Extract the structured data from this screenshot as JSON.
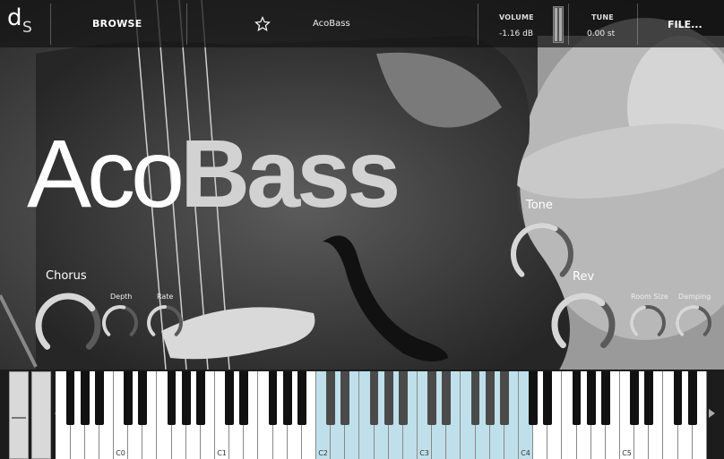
{
  "app": {
    "logo_d": "d",
    "logo_s": "S"
  },
  "header": {
    "browse_label": "BROWSE",
    "preset_name": "AcoBass",
    "volume_label": "VOLUME",
    "volume_value": "-1.16 dB",
    "tune_label": "TUNE",
    "tune_value": "0.00 st",
    "file_label": "FILE..."
  },
  "title": {
    "part1": "Aco",
    "part2": "Bass"
  },
  "knobs": {
    "chorus": {
      "label": "Chorus",
      "value": 0.7
    },
    "depth": {
      "label": "Depth",
      "value": 0.55
    },
    "rate": {
      "label": "Rate",
      "value": 0.5
    },
    "tone": {
      "label": "Tone",
      "value": 0.6
    },
    "rev": {
      "label": "Rev",
      "value": 0.65
    },
    "room_size": {
      "label": "Room Size",
      "value": 0.45
    },
    "damping": {
      "label": "Damping",
      "value": 0.55
    }
  },
  "keyboard": {
    "octave_labels": [
      "C0",
      "C1",
      "C2",
      "C3",
      "C4",
      "C5"
    ],
    "highlight_range": [
      "C2",
      "C4"
    ]
  },
  "colors": {
    "accent": "#bfe0ea",
    "knob_arc": "#d7d7d7",
    "knob_track": "#5a5a5a"
  }
}
